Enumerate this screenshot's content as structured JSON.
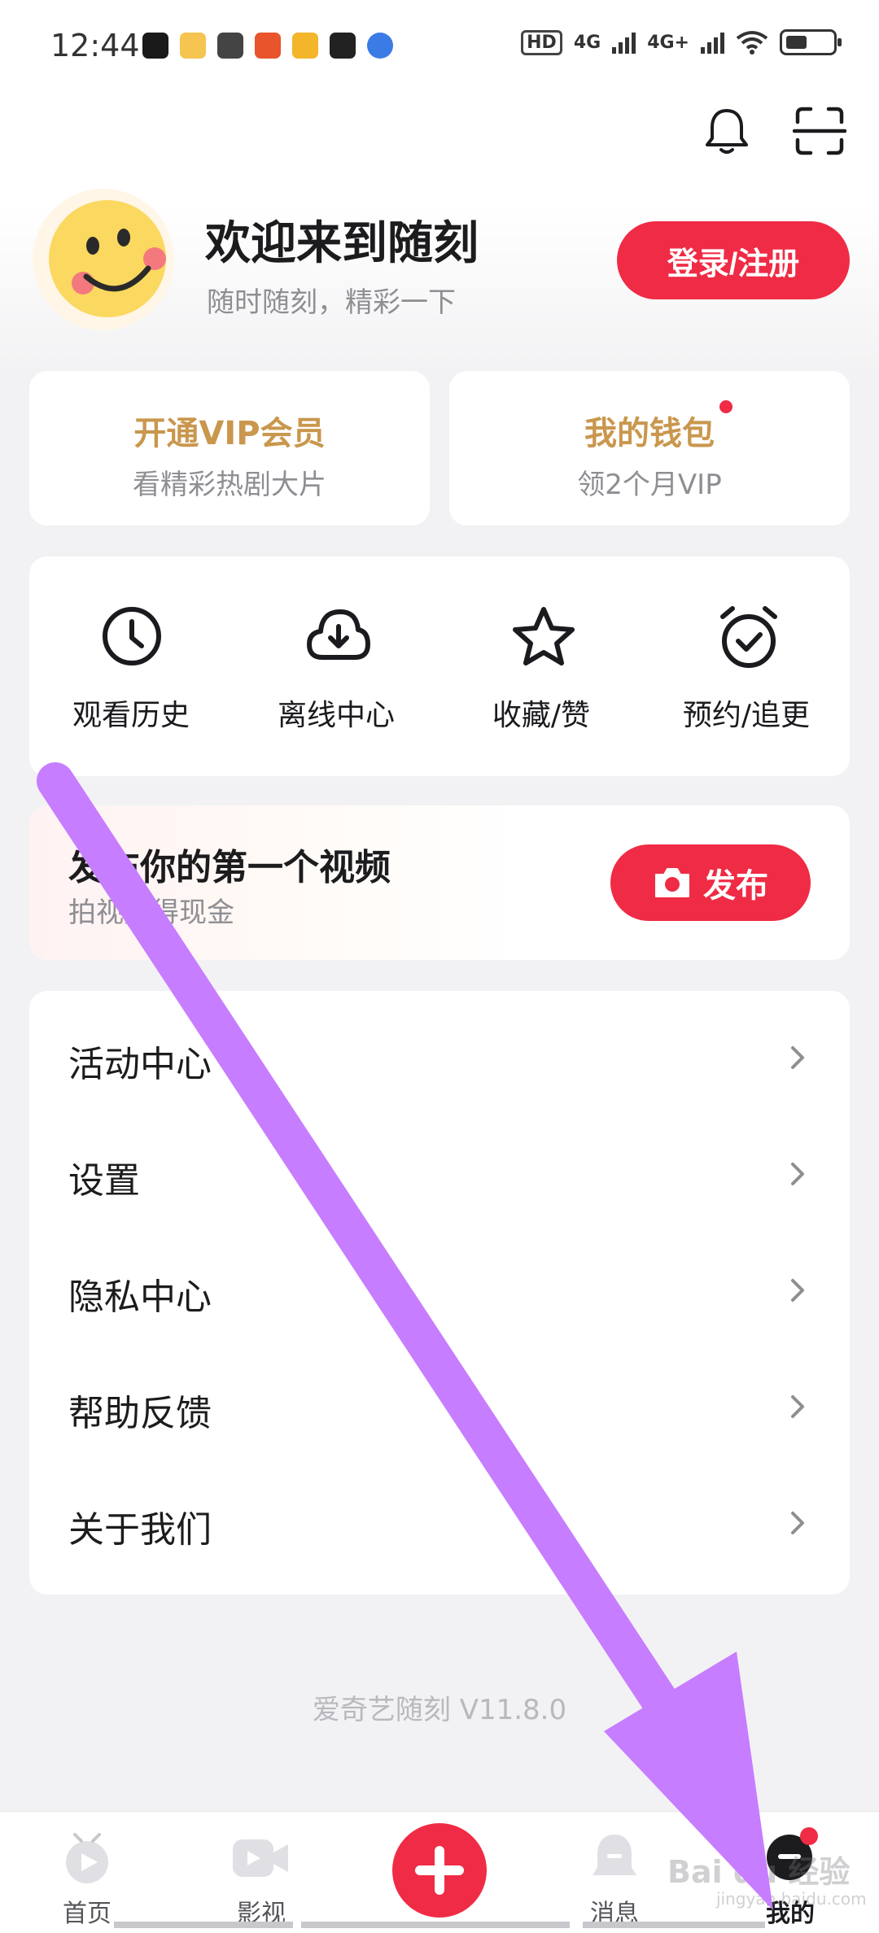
{
  "status_bar": {
    "time": "12:44",
    "hd_label": "HD",
    "net1": "4G",
    "net2": "4G+"
  },
  "header": {
    "bell_icon": "bell-icon",
    "scan_icon": "scan-icon"
  },
  "profile": {
    "title": "欢迎来到随刻",
    "subtitle": "随时随刻，精彩一下",
    "login_label": "登录/注册"
  },
  "cards": {
    "vip": {
      "title": "开通VIP会员",
      "subtitle": "看精彩热剧大片"
    },
    "wallet": {
      "title": "我的钱包",
      "subtitle": "领2个月VIP"
    }
  },
  "features": [
    {
      "label": "观看历史",
      "icon": "clock-icon"
    },
    {
      "label": "离线中心",
      "icon": "cloud-download-icon"
    },
    {
      "label": "收藏/赞",
      "icon": "star-icon"
    },
    {
      "label": "预约/追更",
      "icon": "alarm-check-icon"
    }
  ],
  "publish": {
    "title": "发布你的第一个视频",
    "subtitle": "拍视频得现金",
    "button_label": "发布"
  },
  "menu": [
    {
      "label": "活动中心"
    },
    {
      "label": "设置"
    },
    {
      "label": "隐私中心"
    },
    {
      "label": "帮助反馈"
    },
    {
      "label": "关于我们"
    }
  ],
  "version": "爱奇艺随刻  V11.8.0",
  "tabbar": [
    {
      "label": "首页"
    },
    {
      "label": "影视"
    },
    {
      "label": ""
    },
    {
      "label": "消息"
    },
    {
      "label": "我的"
    }
  ],
  "watermark": {
    "text": "Bai du 经验",
    "sub": "jingyan.baidu.com"
  },
  "colors": {
    "accent": "#f02b45",
    "vip_gold": "#c9974d",
    "arrow": "#c77dff"
  }
}
